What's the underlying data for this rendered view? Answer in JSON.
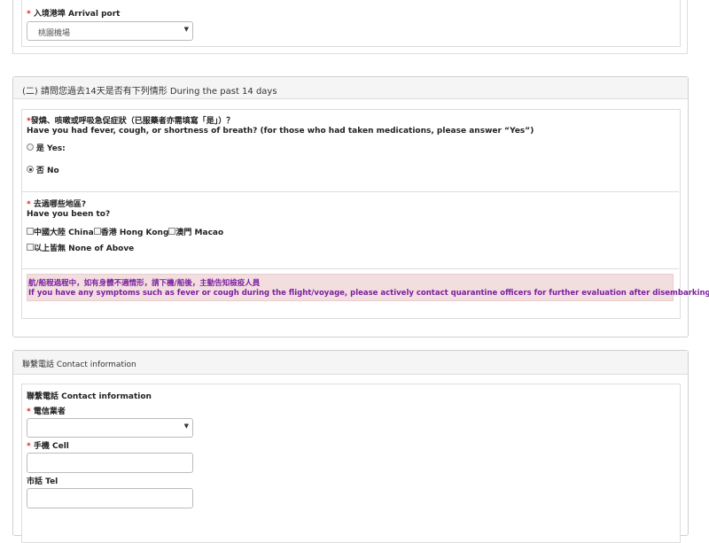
{
  "arrival": {
    "label": "入境港埠 Arrival port",
    "selected": "桃園機場"
  },
  "symptoms_section": {
    "title": "(二) 請問您過去14天是否有下列情形 During the past 14 days",
    "fever_question_line1": "發燒、咳嗽或呼吸急促症狀（已服藥者亦需填寫「是」）？",
    "fever_question_line2": "Have you had fever, cough, or shortness of breath? (for those who had taken medications, please answer “Yes”)",
    "option_yes": "是 Yes:",
    "option_no": "否 No",
    "selected": "no",
    "regions_question_line1": "去過哪些地區?",
    "regions_question_line2": "Have you been to?",
    "region_china": "中國大陸 China",
    "region_hk": "香港 Hong Kong",
    "region_macao": "澳門 Macao",
    "region_none": "以上皆無 None of Above",
    "alert_line1": "航/船程過程中，如有身體不適情形，請下機/船後，主動告知檢疫人員",
    "alert_line2": "If you have any symptoms such as fever or cough during the flight/voyage, please actively contact quarantine officers for further evaluation after disembarking."
  },
  "contact_section": {
    "title": "聯繫電話 Contact information",
    "subtitle": "聯繫電話 Contact information",
    "carrier_label": "電信業者",
    "carrier_selected": "",
    "cell_label": "手機 Cell",
    "cell_value": "",
    "tel_label": "市話 Tel",
    "tel_value": ""
  },
  "colors": {
    "required": "#d9261c",
    "alert_bg": "#f2dede",
    "alert_text": "#7b1fa2",
    "panel_head": "#f5f5f5"
  }
}
